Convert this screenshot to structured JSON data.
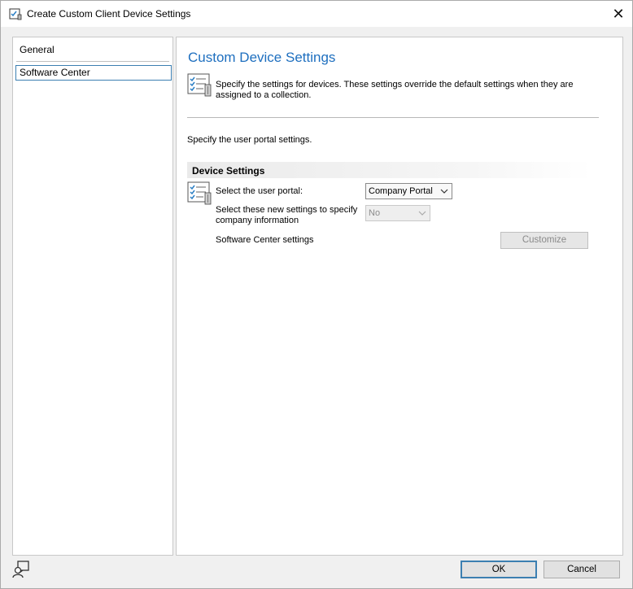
{
  "window": {
    "title": "Create Custom Client Device Settings",
    "close_glyph": "✕"
  },
  "nav": {
    "items": [
      "General",
      "Software Center"
    ],
    "selected_index": 1
  },
  "main": {
    "heading": "Custom Device Settings",
    "intro_text": "Specify the settings for devices. These settings override the default settings when they are assigned to a collection.",
    "portal_intro": "Specify the user portal settings.",
    "section_title": "Device Settings",
    "fields": {
      "user_portal": {
        "label": "Select the user portal:",
        "value": "Company Portal"
      },
      "company_info": {
        "label": "Select these new settings to specify company information",
        "value": "No",
        "disabled": true
      },
      "software_center": {
        "label": "Software Center settings",
        "button": "Customize",
        "disabled": true
      }
    }
  },
  "footer": {
    "ok": "OK",
    "cancel": "Cancel"
  },
  "colors": {
    "heading": "#1e6fbf",
    "selection_border": "#3c7fb1"
  },
  "icons": [
    "checklist-icon",
    "settings-checklist-icon",
    "feedback-icon",
    "chevron-down-icon",
    "close-icon"
  ]
}
